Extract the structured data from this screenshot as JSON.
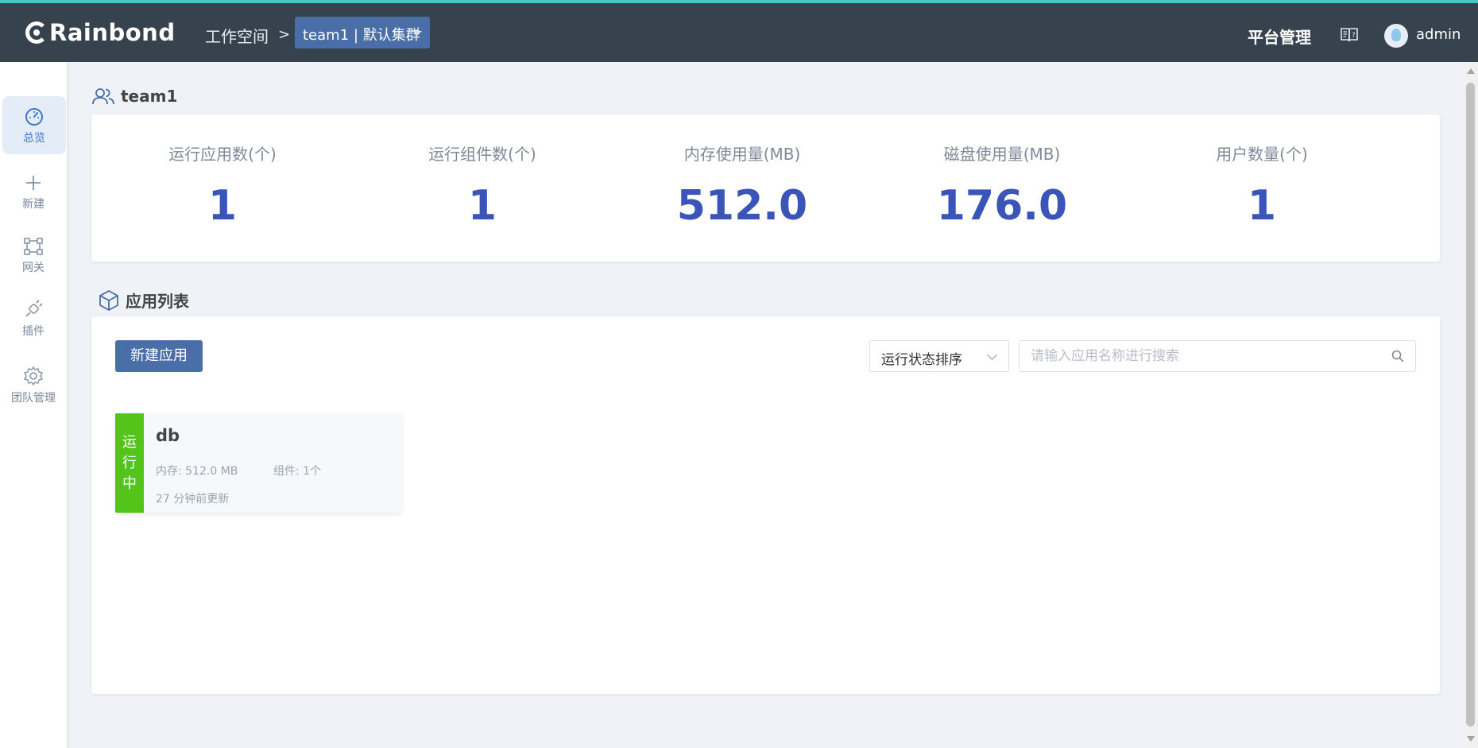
{
  "header": {
    "logo_text": "Rainbond",
    "breadcrumb_workspace": "工作空间",
    "breadcrumb_separator": ">",
    "team_cluster": "team1 | 默认集群",
    "platform_label": "平台管理",
    "user_name": "admin"
  },
  "sidebar": {
    "items": [
      {
        "label": "总览",
        "icon": "dashboard-icon",
        "active": true
      },
      {
        "label": "新建",
        "icon": "plus-icon"
      },
      {
        "label": "网关",
        "icon": "gateway-icon"
      },
      {
        "label": "插件",
        "icon": "plugin-icon"
      },
      {
        "label": "团队管理",
        "icon": "gear-icon"
      }
    ]
  },
  "team": {
    "title": "team1"
  },
  "stats": [
    {
      "label": "运行应用数(个)",
      "value": "1"
    },
    {
      "label": "运行组件数(个)",
      "value": "1"
    },
    {
      "label": "内存使用量(MB)",
      "value": "512.0"
    },
    {
      "label": "磁盘使用量(MB)",
      "value": "176.0"
    },
    {
      "label": "用户数量(个)",
      "value": "1"
    }
  ],
  "app_list": {
    "title": "应用列表",
    "new_app_label": "新建应用",
    "sort_label": "运行状态排序",
    "search_placeholder": "请输入应用名称进行搜索",
    "apps": [
      {
        "status_line1": "运",
        "status_line2": "行",
        "status_line3": "中",
        "name": "db",
        "memory": "内存: 512.0 MB",
        "components": "组件: 1个",
        "updated": "27 分钟前更新"
      }
    ]
  },
  "colors": {
    "header_bg": "#36434f",
    "accent": "#4a6ea8",
    "stat_value": "#3b54b9",
    "running": "#52c41a"
  }
}
